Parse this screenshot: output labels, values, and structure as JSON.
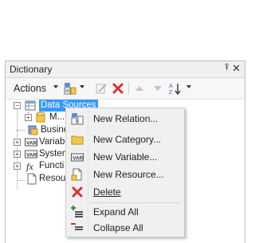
{
  "panel": {
    "title": "Dictionary",
    "pin_glyph": "⍒",
    "close_glyph": "✕"
  },
  "toolbar": {
    "actions_label": "Actions",
    "icons": [
      "new-item-icon",
      "edit-icon",
      "delete-icon",
      "move-up-icon",
      "move-down-icon",
      "sort-icon"
    ]
  },
  "tree": {
    "items": [
      {
        "label": "Data Sources",
        "selected": true,
        "icon": "data-sources-icon"
      },
      {
        "label": "M...",
        "icon": "database-icon"
      },
      {
        "label": "Busine",
        "icon": "business-objects-icon"
      },
      {
        "label": "Variab",
        "icon": "variables-icon"
      },
      {
        "label": "Systen",
        "icon": "system-variables-icon"
      },
      {
        "label": "Functi",
        "icon": "functions-icon"
      },
      {
        "label": "Resou",
        "icon": "resources-icon"
      }
    ]
  },
  "context_menu": {
    "items": [
      {
        "label": "New Relation...",
        "icon": "new-relation-icon"
      },
      {
        "label": "New Category...",
        "icon": "new-category-icon"
      },
      {
        "label": "New Variable...",
        "icon": "new-variable-icon"
      },
      {
        "label": "New Resource...",
        "icon": "new-resource-icon"
      },
      {
        "label": "Delete",
        "icon": "delete-icon"
      },
      {
        "label": "Expand All",
        "icon": "expand-all-icon"
      },
      {
        "label": "Collapse All",
        "icon": "collapse-all-icon"
      }
    ]
  },
  "colors": {
    "selection": "#3399ff",
    "delete_red": "#d9322b",
    "folder_yellow": "#f2c94c",
    "menu_bg": "#f0f0f0"
  }
}
